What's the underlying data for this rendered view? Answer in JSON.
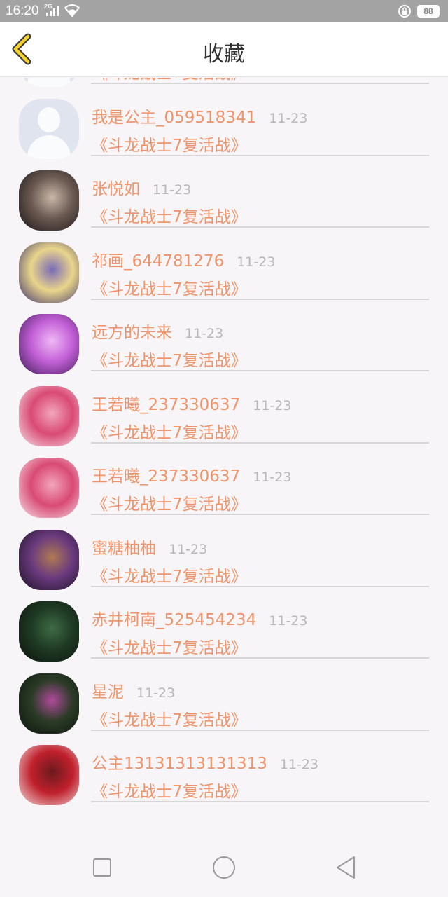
{
  "status": {
    "time": "16:20",
    "signal_label": "2G",
    "battery": "88"
  },
  "header": {
    "title": "收藏"
  },
  "items": [
    {
      "name": "我是公主_059518341",
      "date": "11-23",
      "title": "《斗龙战士7复活战》",
      "avatar": "default-avatar"
    },
    {
      "name": "我是公主_059518341",
      "date": "11-23",
      "title": "《斗龙战士7复活战》",
      "avatar": "default-avatar"
    },
    {
      "name": "张悦如",
      "date": "11-23",
      "title": "《斗龙战士7复活战》",
      "avatar": "photo-avatar",
      "colors": [
        "#1a1416",
        "#6b5a52",
        "#c9b7a8"
      ]
    },
    {
      "name": "祁画_644781276",
      "date": "11-23",
      "title": "《斗龙战士7复活战》",
      "avatar": "photo-avatar",
      "colors": [
        "#3b2f6e",
        "#e9d58a",
        "#7a6ab8"
      ]
    },
    {
      "name": "远方的未来",
      "date": "11-23",
      "title": "《斗龙战士7复活战》",
      "avatar": "photo-avatar",
      "colors": [
        "#3a1a52",
        "#c25fd6",
        "#f0b8f5"
      ]
    },
    {
      "name": "王若曦_237330637",
      "date": "11-23",
      "title": "《斗龙战士7复活战》",
      "avatar": "photo-avatar",
      "colors": [
        "#f7e8ee",
        "#d94a73",
        "#f2a6bd"
      ]
    },
    {
      "name": "王若曦_237330637",
      "date": "11-23",
      "title": "《斗龙战士7复活战》",
      "avatar": "photo-avatar",
      "colors": [
        "#f7e8ee",
        "#d94a73",
        "#f2a6bd"
      ]
    },
    {
      "name": "蜜糖柚柚",
      "date": "11-23",
      "title": "《斗龙战士7复活战》",
      "avatar": "photo-avatar",
      "colors": [
        "#1a1022",
        "#6a3a7e",
        "#b07a52"
      ]
    },
    {
      "name": "赤井柯南_525454234",
      "date": "11-23",
      "title": "《斗龙战士7复活战》",
      "avatar": "photo-avatar",
      "colors": [
        "#0b120d",
        "#1f3a24",
        "#3e6b45"
      ]
    },
    {
      "name": "星泥",
      "date": "11-23",
      "title": "《斗龙战士7复活战》",
      "avatar": "photo-avatar",
      "colors": [
        "#0d140e",
        "#2a3b26",
        "#b04a9a"
      ]
    },
    {
      "name": "公主13131313131313",
      "date": "11-23",
      "title": "《斗龙战士7复活战》",
      "avatar": "photo-avatar",
      "colors": [
        "#f2e4e4",
        "#c0202c",
        "#6b1a1e"
      ]
    }
  ]
}
